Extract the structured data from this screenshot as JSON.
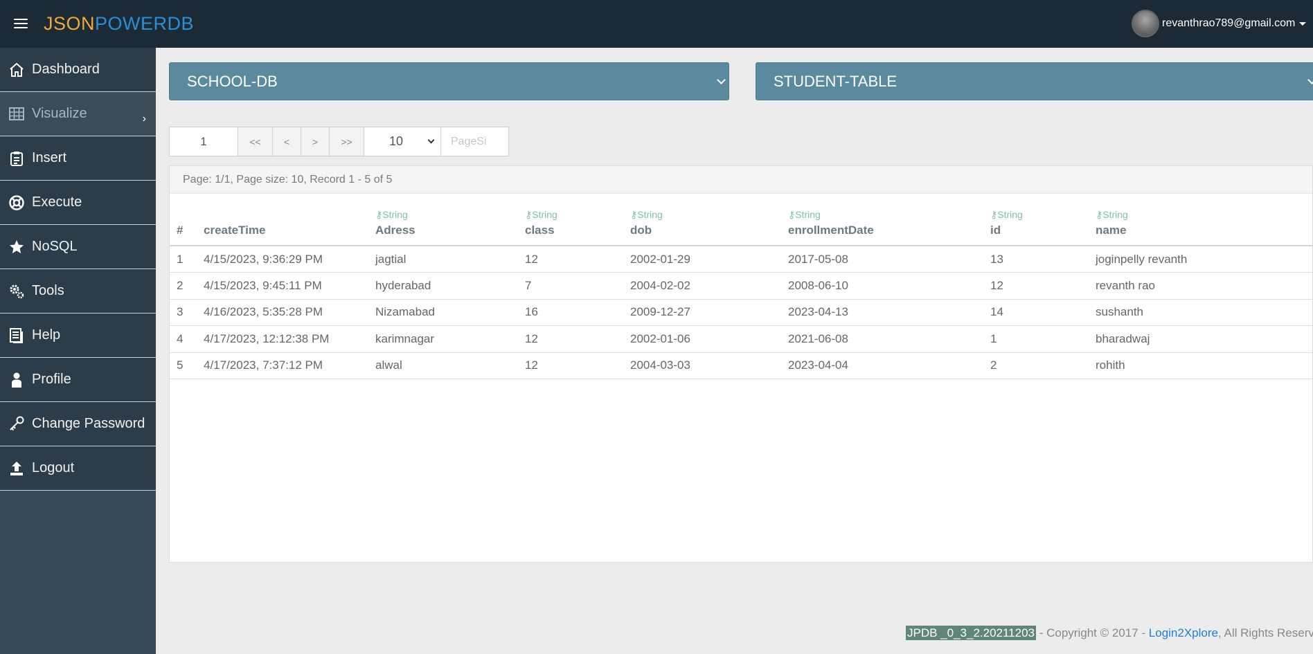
{
  "brand": {
    "part1": "JSON",
    "part2": "POWERDB"
  },
  "user": {
    "email": "revanthrao789@gmail.com"
  },
  "sidebar": {
    "items": [
      {
        "label": "Dashboard",
        "icon": "home-icon"
      },
      {
        "label": "Visualize",
        "icon": "table-icon"
      },
      {
        "label": "Insert",
        "icon": "clipboard-icon"
      },
      {
        "label": "Execute",
        "icon": "lifebuoy-icon"
      },
      {
        "label": "NoSQL",
        "icon": "star-icon"
      },
      {
        "label": "Tools",
        "icon": "gears-icon"
      },
      {
        "label": "Help",
        "icon": "document-icon"
      },
      {
        "label": "Profile",
        "icon": "user-icon"
      },
      {
        "label": "Change Password",
        "icon": "key-icon"
      },
      {
        "label": "Logout",
        "icon": "upload-icon"
      }
    ]
  },
  "selectors": {
    "database": "SCHOOL-DB",
    "table": "STUDENT-TABLE"
  },
  "pager": {
    "page_value": "1",
    "first": "<<",
    "prev": "<",
    "next": ">",
    "last": ">>",
    "page_size": "10",
    "page_size_placeholder": "PageSi"
  },
  "page_info": "Page: 1/1, Page size: 10, Record 1 - 5 of 5",
  "table": {
    "type_label": "String",
    "columns": [
      "#",
      "createTime",
      "Adress",
      "class",
      "dob",
      "enrollmentDate",
      "id",
      "name"
    ],
    "rows": [
      [
        "1",
        "4/15/2023, 9:36:29 PM",
        "jagtial",
        "12",
        "2002-01-29",
        "2017-05-08",
        "13",
        "joginpelly revanth"
      ],
      [
        "2",
        "4/15/2023, 9:45:11 PM",
        "hyderabad",
        "7",
        "2004-02-02",
        "2008-06-10",
        "12",
        "revanth rao"
      ],
      [
        "3",
        "4/16/2023, 5:35:28 PM",
        "Nizamabad",
        "16",
        "2009-12-27",
        "2023-04-13",
        "14",
        "sushanth"
      ],
      [
        "4",
        "4/17/2023, 12:12:38 PM",
        "karimnagar",
        "12",
        "2002-01-06",
        "2021-06-08",
        "1",
        "bharadwaj"
      ],
      [
        "5",
        "4/17/2023, 7:37:12 PM",
        "alwal",
        "12",
        "2004-03-03",
        "2023-04-04",
        "2",
        "rohith"
      ]
    ]
  },
  "footer": {
    "version": "JPDB _0_3_2.20211203",
    "copyright": " - Copyright © 2017 - ",
    "link": "Login2Xplore",
    "rights": ", All Rights Reserved"
  }
}
